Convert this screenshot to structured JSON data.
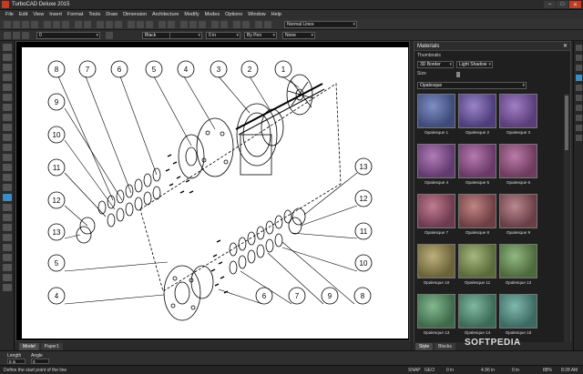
{
  "window": {
    "title": "TurboCAD Deluxe 2015",
    "controls": [
      "–",
      "□",
      "✕"
    ]
  },
  "menu": [
    "File",
    "Edit",
    "View",
    "Insert",
    "Format",
    "Tools",
    "Draw",
    "Dimension",
    "Architecture",
    "Modify",
    "Modes",
    "Options",
    "Window",
    "Help"
  ],
  "toolbar": {
    "line_style": "Normal Lines",
    "layer_value": "0",
    "pen_color": "Black",
    "width_value": "0 in",
    "color_mode": "By Pen",
    "fill": "None"
  },
  "canvas": {
    "tabs": [
      "Model",
      "Paper1"
    ],
    "callouts_top": [
      "8",
      "7",
      "6",
      "5",
      "4",
      "3",
      "2",
      "1"
    ],
    "callouts_left": [
      "9",
      "10",
      "11",
      "12",
      "13"
    ],
    "callouts_lower_left": [
      "5",
      "4"
    ],
    "callouts_lower_bottom": [
      "6",
      "7",
      "9",
      "8"
    ],
    "callouts_right": [
      "13",
      "12",
      "11",
      "10"
    ]
  },
  "materials_panel": {
    "title": "Materials",
    "thumbnails_label": "Thumbnails",
    "render_mode": "3D Border",
    "light_mode": "Light Shadow",
    "size_label": "Size",
    "category": "Opalesque",
    "swatches": [
      {
        "label": "Opalesque 1",
        "color": "#3d4a7a",
        "color2": "#7f8fc4"
      },
      {
        "label": "Opalesque 2",
        "color": "#4d3d7a",
        "color2": "#9a84c8"
      },
      {
        "label": "Opalesque 3",
        "color": "#5b3d7a",
        "color2": "#a07ec4"
      },
      {
        "label": "Opalesque 4",
        "color": "#613a6e",
        "color2": "#b07cb8"
      },
      {
        "label": "Opalesque 5",
        "color": "#6a3866",
        "color2": "#b67ab0"
      },
      {
        "label": "Opalesque 6",
        "color": "#6e3a5e",
        "color2": "#bb7ca8"
      },
      {
        "label": "Opalesque 7",
        "color": "#6e3a4e",
        "color2": "#c07c90"
      },
      {
        "label": "Opalesque 8",
        "color": "#6e3e42",
        "color2": "#c08484"
      },
      {
        "label": "Opalesque 9",
        "color": "#6a3e46",
        "color2": "#b98890"
      },
      {
        "label": "Opalesque 10",
        "color": "#6a6238",
        "color2": "#bdb07c"
      },
      {
        "label": "Opalesque 11",
        "color": "#5a6a3a",
        "color2": "#a6b87e"
      },
      {
        "label": "Opalesque 12",
        "color": "#4d6a3c",
        "color2": "#92b882"
      },
      {
        "label": "Opalesque 13",
        "color": "#3e6a4a",
        "color2": "#84b890"
      },
      {
        "label": "Opalesque 14",
        "color": "#3c6a58",
        "color2": "#80b8a0"
      },
      {
        "label": "Opalesque 15",
        "color": "#3c6a62",
        "color2": "#80b8ac"
      }
    ],
    "tabs": [
      "Style",
      "Blocks"
    ]
  },
  "inspector": {
    "length_label": "Length",
    "length_value": "0 in",
    "angle_label": "Angle",
    "angle_value": "0"
  },
  "status": {
    "prompt": "Define the start point of the line",
    "snap": "SNAP",
    "geo": "GEO",
    "x": "0 in",
    "y": "4.96 in",
    "z": "0 in",
    "zoom": "88%",
    "time": "8:28 AM"
  },
  "watermark": "SOFTPEDIA"
}
